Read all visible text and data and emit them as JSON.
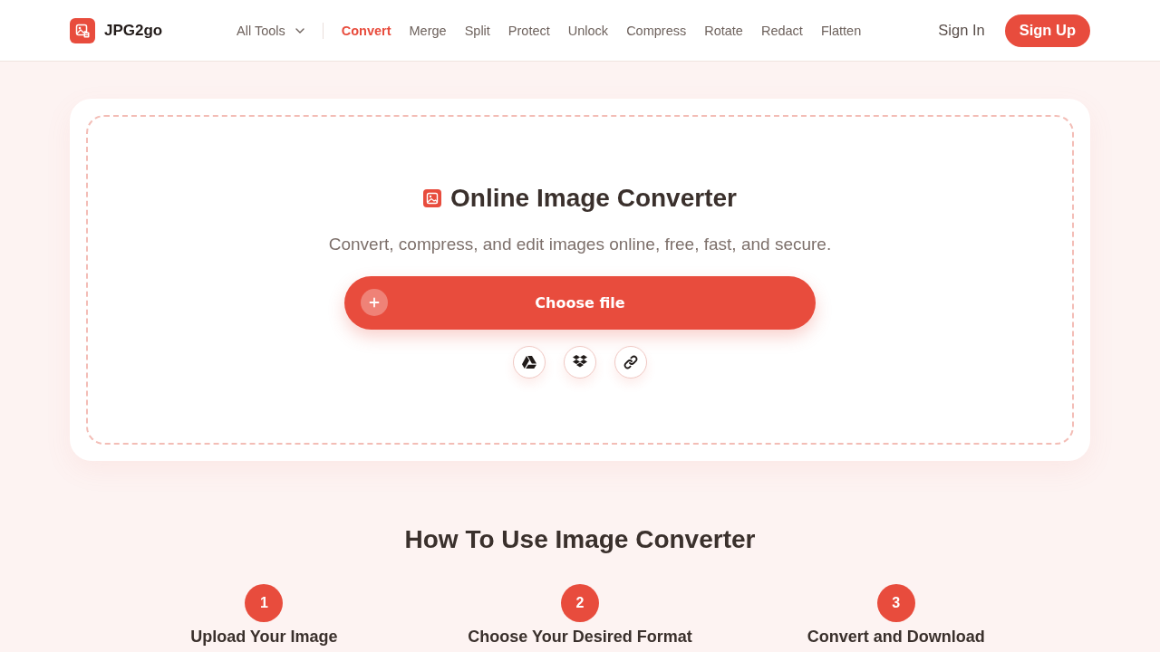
{
  "header": {
    "logo": {
      "label": "JPG2go"
    },
    "all_tools": {
      "label": "All Tools"
    },
    "nav": [
      {
        "label": "Convert",
        "selected": true
      },
      {
        "label": "Merge",
        "selected": false
      },
      {
        "label": "Split",
        "selected": false
      },
      {
        "label": "Protect",
        "selected": false
      },
      {
        "label": "Unlock",
        "selected": false
      },
      {
        "label": "Compress",
        "selected": false
      },
      {
        "label": "Rotate",
        "selected": false
      },
      {
        "label": "Redact",
        "selected": false
      },
      {
        "label": "Flatten",
        "selected": false
      }
    ],
    "sign_in": "Sign In",
    "sign_up": "Sign Up"
  },
  "hero": {
    "title": "Online Image Converter",
    "subtitle": "Convert, compress, and edit images online, free, fast, and secure.",
    "choose_button": "Choose file"
  },
  "how_to": {
    "title": "How To Use Image Converter",
    "steps": [
      {
        "number": "1",
        "title": "Upload Your Image"
      },
      {
        "number": "2",
        "title": "Choose Your Desired Format"
      },
      {
        "number": "3",
        "title": "Convert and Download"
      }
    ]
  }
}
